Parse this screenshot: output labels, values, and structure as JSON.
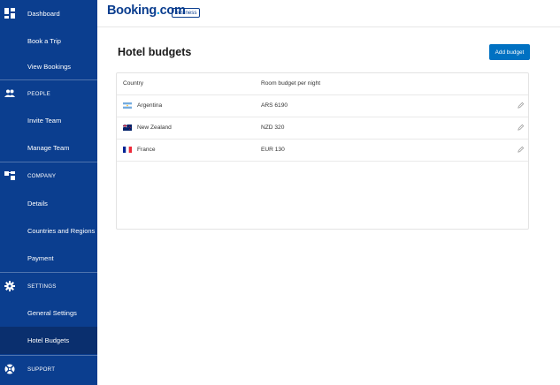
{
  "sidebar": {
    "items": [
      {
        "label": "Dashboard",
        "icon": "dashboard-icon",
        "type": "item"
      },
      {
        "label": "Book a Trip",
        "type": "item"
      },
      {
        "label": "View Bookings",
        "type": "item"
      },
      {
        "label": "PEOPLE",
        "icon": "people-icon",
        "type": "section"
      },
      {
        "label": "Invite Team",
        "type": "item"
      },
      {
        "label": "Manage Team",
        "type": "item"
      },
      {
        "label": "COMPANY",
        "icon": "company-icon",
        "type": "section"
      },
      {
        "label": "Details",
        "type": "item"
      },
      {
        "label": "Countries and Regions",
        "type": "item"
      },
      {
        "label": "Payment",
        "type": "item"
      },
      {
        "label": "SETTINGS",
        "icon": "gear-icon",
        "type": "section"
      },
      {
        "label": "General Settings",
        "type": "item"
      },
      {
        "label": "Hotel Budgets",
        "type": "item",
        "active": true
      },
      {
        "label": "SUPPORT",
        "icon": "support-icon",
        "type": "section"
      }
    ]
  },
  "header": {
    "logo_text": "Booking",
    "logo_dot": ".",
    "logo_suffix": "com",
    "logo_badge": "business"
  },
  "main": {
    "title": "Hotel budgets",
    "add_button": "Add budget",
    "table": {
      "columns": [
        "Country",
        "Room budget per night"
      ],
      "rows": [
        {
          "country": "Argentina",
          "budget": "ARS 6190",
          "flag": "argentina-flag"
        },
        {
          "country": "New Zealand",
          "budget": "NZD 320",
          "flag": "new-zealand-flag"
        },
        {
          "country": "France",
          "budget": "EUR 130",
          "flag": "france-flag"
        }
      ]
    }
  },
  "colors": {
    "sidebar_bg": "#0b3e8f",
    "sidebar_active": "#0a2f6e",
    "brand": "#0b3e8f",
    "brand_dot": "#009fe3",
    "button": "#0071c2"
  }
}
